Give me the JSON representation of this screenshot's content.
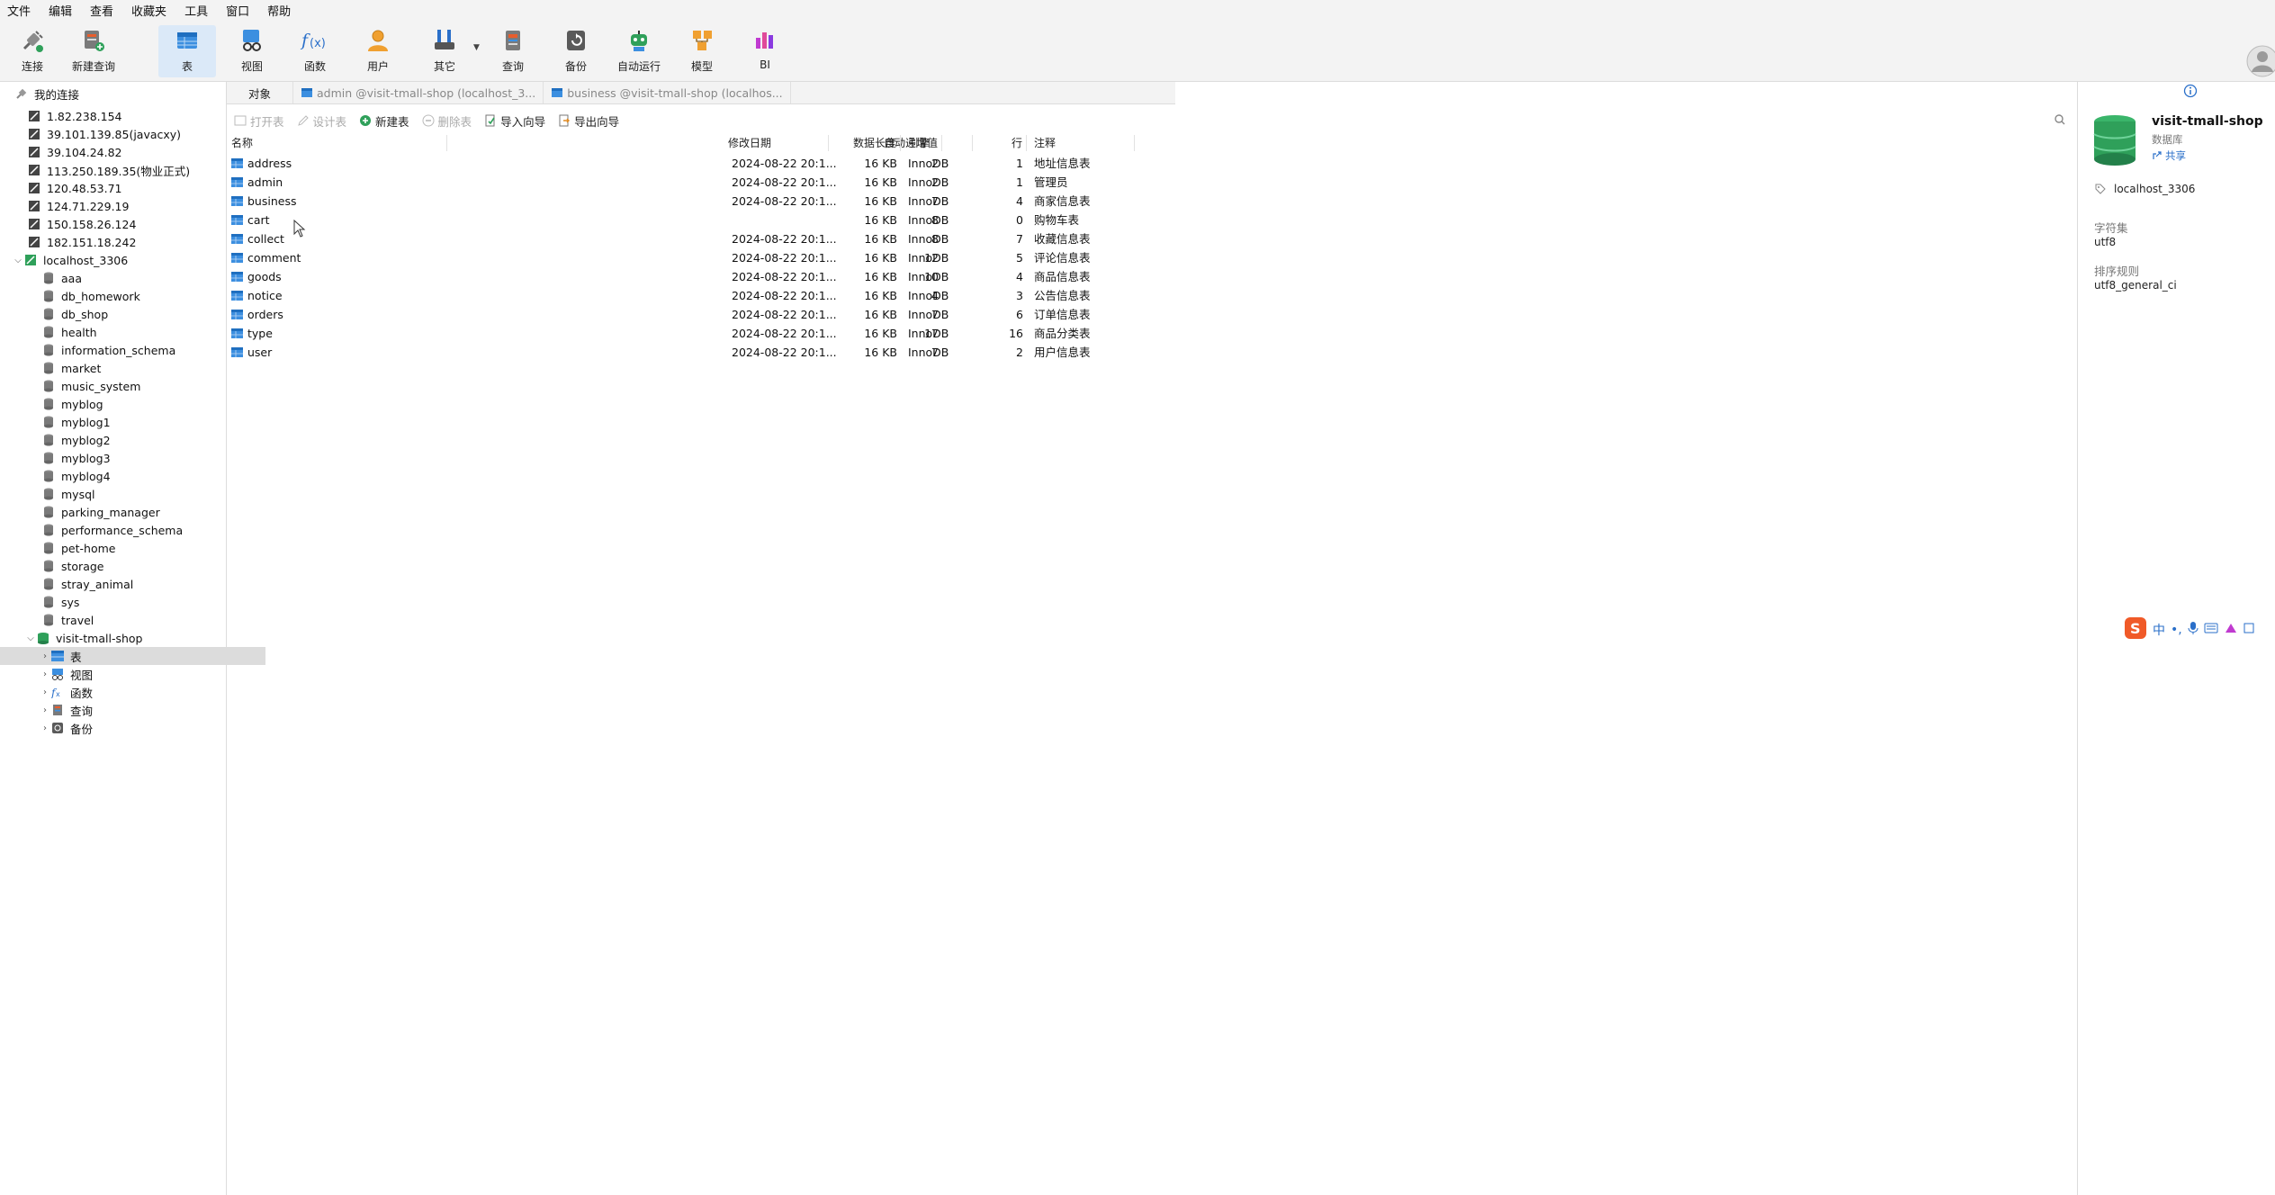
{
  "menu": [
    "文件",
    "编辑",
    "查看",
    "收藏夹",
    "工具",
    "窗口",
    "帮助"
  ],
  "toolbar": {
    "connect": "连接",
    "new_query": "新建查询",
    "table": "表",
    "view": "视图",
    "function": "函数",
    "user": "用户",
    "other": "其它",
    "query": "查询",
    "backup": "备份",
    "auto_run": "自动运行",
    "model": "模型",
    "bi": "BI"
  },
  "sidebar": {
    "root": "我的连接",
    "connections": [
      "1.82.238.154",
      "39.101.139.85(javacxy)",
      "39.104.24.82",
      "113.250.189.35(物业正式)",
      "120.48.53.71",
      "124.71.229.19",
      "150.158.26.124",
      "182.151.18.242"
    ],
    "local": "localhost_3306",
    "databases": [
      "aaa",
      "db_homework",
      "db_shop",
      "health",
      "information_schema",
      "market",
      "music_system",
      "myblog",
      "myblog1",
      "myblog2",
      "myblog3",
      "myblog4",
      "mysql",
      "parking_manager",
      "performance_schema",
      "pet-home",
      "storage",
      "stray_animal",
      "sys",
      "travel"
    ],
    "active_db": "visit-tmall-shop",
    "children": [
      "表",
      "视图",
      "函数",
      "查询",
      "备份"
    ]
  },
  "tabs": [
    "对象",
    "admin @visit-tmall-shop (localhost_3...",
    "business @visit-tmall-shop (localhos..."
  ],
  "object_toolbar": {
    "open": "打开表",
    "design": "设计表",
    "new": "新建表",
    "delete": "删除表",
    "import": "导入向导",
    "export": "导出向导"
  },
  "columns": {
    "name": "名称",
    "auto_inc": "自动递增值",
    "modified": "修改日期",
    "data_len": "数据长度",
    "engine": "引擎",
    "rows": "行",
    "comment": "注释"
  },
  "tables": [
    {
      "name": "address",
      "auto_inc": "2",
      "modified": "2024-08-22 20:1...",
      "data_len": "16 KB",
      "engine": "InnoDB",
      "rows": "1",
      "comment": "地址信息表"
    },
    {
      "name": "admin",
      "auto_inc": "2",
      "modified": "2024-08-22 20:1...",
      "data_len": "16 KB",
      "engine": "InnoDB",
      "rows": "1",
      "comment": "管理员"
    },
    {
      "name": "business",
      "auto_inc": "7",
      "modified": "2024-08-22 20:1...",
      "data_len": "16 KB",
      "engine": "InnoDB",
      "rows": "4",
      "comment": "商家信息表"
    },
    {
      "name": "cart",
      "auto_inc": "8",
      "modified": "",
      "data_len": "16 KB",
      "engine": "InnoDB",
      "rows": "0",
      "comment": "购物车表"
    },
    {
      "name": "collect",
      "auto_inc": "8",
      "modified": "2024-08-22 20:1...",
      "data_len": "16 KB",
      "engine": "InnoDB",
      "rows": "7",
      "comment": "收藏信息表"
    },
    {
      "name": "comment",
      "auto_inc": "12",
      "modified": "2024-08-22 20:1...",
      "data_len": "16 KB",
      "engine": "InnoDB",
      "rows": "5",
      "comment": "评论信息表"
    },
    {
      "name": "goods",
      "auto_inc": "10",
      "modified": "2024-08-22 20:1...",
      "data_len": "16 KB",
      "engine": "InnoDB",
      "rows": "4",
      "comment": "商品信息表"
    },
    {
      "name": "notice",
      "auto_inc": "4",
      "modified": "2024-08-22 20:1...",
      "data_len": "16 KB",
      "engine": "InnoDB",
      "rows": "3",
      "comment": "公告信息表"
    },
    {
      "name": "orders",
      "auto_inc": "7",
      "modified": "2024-08-22 20:1...",
      "data_len": "16 KB",
      "engine": "InnoDB",
      "rows": "6",
      "comment": "订单信息表"
    },
    {
      "name": "type",
      "auto_inc": "17",
      "modified": "2024-08-22 20:1...",
      "data_len": "16 KB",
      "engine": "InnoDB",
      "rows": "16",
      "comment": "商品分类表"
    },
    {
      "name": "user",
      "auto_inc": "7",
      "modified": "2024-08-22 20:1...",
      "data_len": "16 KB",
      "engine": "InnoDB",
      "rows": "2",
      "comment": "用户信息表"
    }
  ],
  "right_panel": {
    "db_name": "visit-tmall-shop",
    "db_type": "数据库",
    "share": "共享",
    "connection": "localhost_3306",
    "charset_label": "字符集",
    "charset": "utf8",
    "collation_label": "排序规则",
    "collation": "utf8_general_ci"
  },
  "ime": {
    "lang": "中"
  },
  "colors": {
    "accent": "#2a6fc9",
    "db_green": "#2fa05a",
    "selected": "#dbe9f8"
  }
}
